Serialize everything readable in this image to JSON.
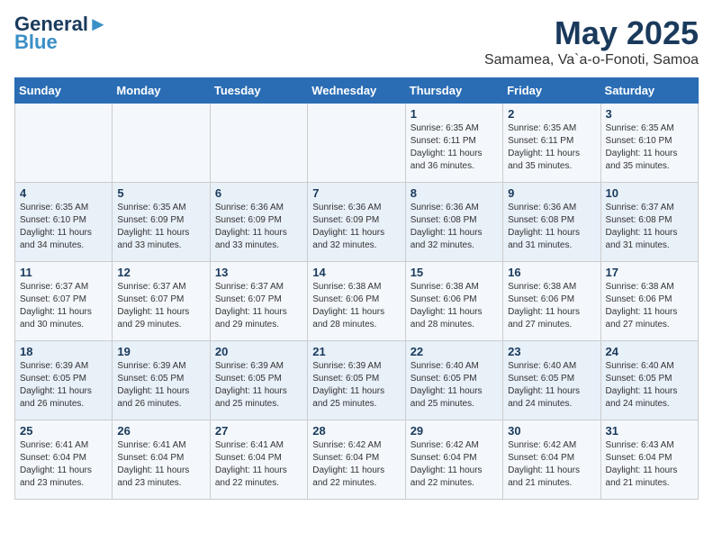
{
  "logo": {
    "name_part1": "General",
    "name_part2": "Blue",
    "tagline": ""
  },
  "calendar": {
    "title": "May 2025",
    "subtitle": "Samamea, Va`a-o-Fonoti, Samoa"
  },
  "weekdays": [
    "Sunday",
    "Monday",
    "Tuesday",
    "Wednesday",
    "Thursday",
    "Friday",
    "Saturday"
  ],
  "weeks": [
    [
      {
        "day": "",
        "info": ""
      },
      {
        "day": "",
        "info": ""
      },
      {
        "day": "",
        "info": ""
      },
      {
        "day": "",
        "info": ""
      },
      {
        "day": "1",
        "info": "Sunrise: 6:35 AM\nSunset: 6:11 PM\nDaylight: 11 hours\nand 36 minutes."
      },
      {
        "day": "2",
        "info": "Sunrise: 6:35 AM\nSunset: 6:11 PM\nDaylight: 11 hours\nand 35 minutes."
      },
      {
        "day": "3",
        "info": "Sunrise: 6:35 AM\nSunset: 6:10 PM\nDaylight: 11 hours\nand 35 minutes."
      }
    ],
    [
      {
        "day": "4",
        "info": "Sunrise: 6:35 AM\nSunset: 6:10 PM\nDaylight: 11 hours\nand 34 minutes."
      },
      {
        "day": "5",
        "info": "Sunrise: 6:35 AM\nSunset: 6:09 PM\nDaylight: 11 hours\nand 33 minutes."
      },
      {
        "day": "6",
        "info": "Sunrise: 6:36 AM\nSunset: 6:09 PM\nDaylight: 11 hours\nand 33 minutes."
      },
      {
        "day": "7",
        "info": "Sunrise: 6:36 AM\nSunset: 6:09 PM\nDaylight: 11 hours\nand 32 minutes."
      },
      {
        "day": "8",
        "info": "Sunrise: 6:36 AM\nSunset: 6:08 PM\nDaylight: 11 hours\nand 32 minutes."
      },
      {
        "day": "9",
        "info": "Sunrise: 6:36 AM\nSunset: 6:08 PM\nDaylight: 11 hours\nand 31 minutes."
      },
      {
        "day": "10",
        "info": "Sunrise: 6:37 AM\nSunset: 6:08 PM\nDaylight: 11 hours\nand 31 minutes."
      }
    ],
    [
      {
        "day": "11",
        "info": "Sunrise: 6:37 AM\nSunset: 6:07 PM\nDaylight: 11 hours\nand 30 minutes."
      },
      {
        "day": "12",
        "info": "Sunrise: 6:37 AM\nSunset: 6:07 PM\nDaylight: 11 hours\nand 29 minutes."
      },
      {
        "day": "13",
        "info": "Sunrise: 6:37 AM\nSunset: 6:07 PM\nDaylight: 11 hours\nand 29 minutes."
      },
      {
        "day": "14",
        "info": "Sunrise: 6:38 AM\nSunset: 6:06 PM\nDaylight: 11 hours\nand 28 minutes."
      },
      {
        "day": "15",
        "info": "Sunrise: 6:38 AM\nSunset: 6:06 PM\nDaylight: 11 hours\nand 28 minutes."
      },
      {
        "day": "16",
        "info": "Sunrise: 6:38 AM\nSunset: 6:06 PM\nDaylight: 11 hours\nand 27 minutes."
      },
      {
        "day": "17",
        "info": "Sunrise: 6:38 AM\nSunset: 6:06 PM\nDaylight: 11 hours\nand 27 minutes."
      }
    ],
    [
      {
        "day": "18",
        "info": "Sunrise: 6:39 AM\nSunset: 6:05 PM\nDaylight: 11 hours\nand 26 minutes."
      },
      {
        "day": "19",
        "info": "Sunrise: 6:39 AM\nSunset: 6:05 PM\nDaylight: 11 hours\nand 26 minutes."
      },
      {
        "day": "20",
        "info": "Sunrise: 6:39 AM\nSunset: 6:05 PM\nDaylight: 11 hours\nand 25 minutes."
      },
      {
        "day": "21",
        "info": "Sunrise: 6:39 AM\nSunset: 6:05 PM\nDaylight: 11 hours\nand 25 minutes."
      },
      {
        "day": "22",
        "info": "Sunrise: 6:40 AM\nSunset: 6:05 PM\nDaylight: 11 hours\nand 25 minutes."
      },
      {
        "day": "23",
        "info": "Sunrise: 6:40 AM\nSunset: 6:05 PM\nDaylight: 11 hours\nand 24 minutes."
      },
      {
        "day": "24",
        "info": "Sunrise: 6:40 AM\nSunset: 6:05 PM\nDaylight: 11 hours\nand 24 minutes."
      }
    ],
    [
      {
        "day": "25",
        "info": "Sunrise: 6:41 AM\nSunset: 6:04 PM\nDaylight: 11 hours\nand 23 minutes."
      },
      {
        "day": "26",
        "info": "Sunrise: 6:41 AM\nSunset: 6:04 PM\nDaylight: 11 hours\nand 23 minutes."
      },
      {
        "day": "27",
        "info": "Sunrise: 6:41 AM\nSunset: 6:04 PM\nDaylight: 11 hours\nand 22 minutes."
      },
      {
        "day": "28",
        "info": "Sunrise: 6:42 AM\nSunset: 6:04 PM\nDaylight: 11 hours\nand 22 minutes."
      },
      {
        "day": "29",
        "info": "Sunrise: 6:42 AM\nSunset: 6:04 PM\nDaylight: 11 hours\nand 22 minutes."
      },
      {
        "day": "30",
        "info": "Sunrise: 6:42 AM\nSunset: 6:04 PM\nDaylight: 11 hours\nand 21 minutes."
      },
      {
        "day": "31",
        "info": "Sunrise: 6:43 AM\nSunset: 6:04 PM\nDaylight: 11 hours\nand 21 minutes."
      }
    ]
  ]
}
